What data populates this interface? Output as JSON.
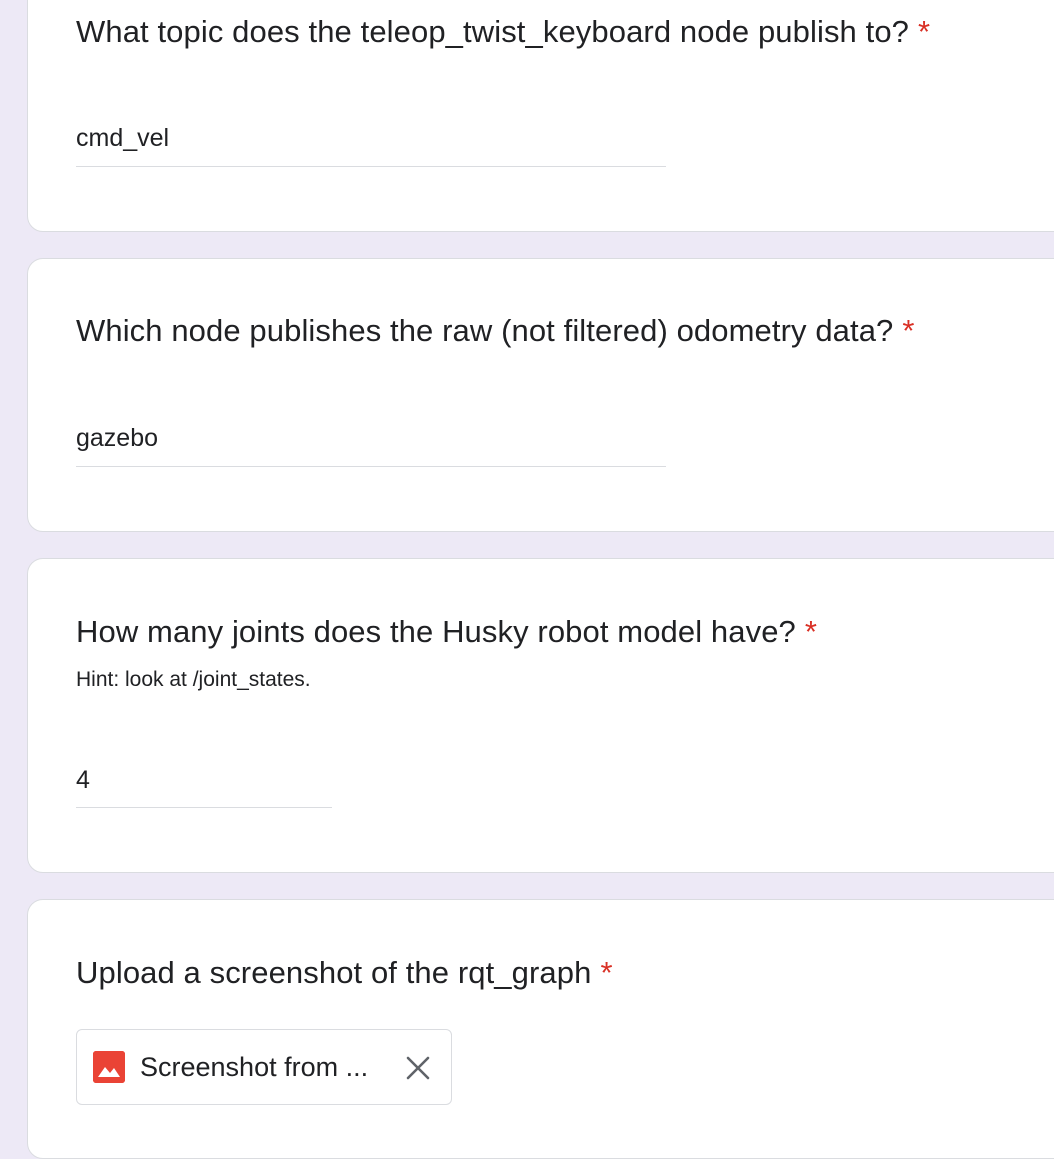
{
  "questions": [
    {
      "title": "What topic does the teleop_twist_keyboard node publish to?",
      "required_mark": "*",
      "answer": "cmd_vel"
    },
    {
      "title": "Which node publishes the raw (not filtered) odometry data?",
      "required_mark": "*",
      "answer": "gazebo"
    },
    {
      "title": "How many joints does the Husky robot model have?",
      "required_mark": "*",
      "hint": "Hint: look at /joint_states.",
      "answer": "4"
    },
    {
      "title": "Upload a screenshot of the rqt_graph",
      "required_mark": "*",
      "uploaded_file": {
        "name": "Screenshot from ...",
        "icon": "image-file-icon",
        "remove_icon": "close-icon"
      }
    }
  ],
  "colors": {
    "background": "#ede9f6",
    "card": "#ffffff",
    "required": "#d93025",
    "image_icon": "#ea4335",
    "divider": "#dadce0"
  }
}
